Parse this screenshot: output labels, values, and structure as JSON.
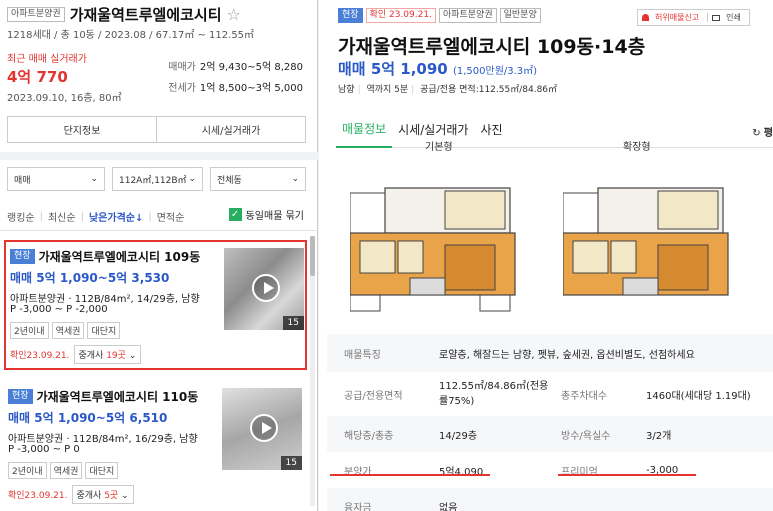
{
  "complex": {
    "type_tag": "아파트분양권",
    "name": "가재울역트루엘에코시티",
    "summary": "1218세대 / 총 10동 / 2023.08 / 67.17㎡ ~ 112.55㎡",
    "recent_label": "최근 매매 실거래가",
    "recent_price": "4억 770",
    "recent_date": "2023.09.10, 16층, 80㎡",
    "sale_range_label": "매매가",
    "sale_range": "2억 9,430~5억 8,280",
    "jeonse_range_label": "전세가",
    "jeonse_range": "1억 8,500~3억 5,000",
    "btn_info": "단지정보",
    "btn_price": "시세/실거래가"
  },
  "filters": {
    "trade": "매매",
    "area": "112A㎡,112B㎡",
    "dong": "전체동"
  },
  "sort": {
    "items": [
      "랭킹순",
      "최신순",
      "낮은가격순↓",
      "면적순"
    ],
    "bundle": "동일매물 묶기"
  },
  "listings": [
    {
      "badge": "현장",
      "name": "가재울역트루엘에코시티 109동",
      "price": "매매 5억 1,090~5억 3,530",
      "line1": "아파트분양권 · 112B/84m², 14/29층, 남향",
      "line2": "P -3,000 ~ P -2,000",
      "chips": [
        "2년이내",
        "역세권",
        "대단지"
      ],
      "confirmed": "확인23.09.21.",
      "agents_prefix": "중개사 ",
      "agents_count": "19곳",
      "photo_count": "15"
    },
    {
      "badge": "현장",
      "name": "가재울역트루엘에코시티 110동",
      "price": "매매 5억 1,090~5억 6,510",
      "line1": "아파트분양권 · 112B/84m², 16/29층, 남향",
      "line2": "P -3,000 ~ P 0",
      "chips": [
        "2년이내",
        "역세권",
        "대단지"
      ],
      "confirmed": "확인23.09.21.",
      "agents_prefix": "중개사 ",
      "agents_count": "5곳",
      "photo_count": "15"
    }
  ],
  "detail": {
    "tags": [
      "현장",
      "확인 23.09.21.",
      "아파트분양권",
      "일반분양"
    ],
    "report": "허위매물신고",
    "print": "인쇄",
    "title": "가재울역트루엘에코시티 109동·14층",
    "price": "매매 5억 1,090",
    "price_per": "(1,500만원/3.3㎡)",
    "meta": [
      "남향",
      "역까지 5분",
      "공급/전용 면적:112.55㎡/84.86㎡"
    ],
    "tabs": [
      "매물정보",
      "시세/실거래가",
      "사진"
    ],
    "tab_right": "평",
    "plan_basic": "기본형",
    "plan_ext": "확장형",
    "rows": [
      {
        "k": "매물특징",
        "v": "로얄층, 해잘드는 남향, 펫뷰, 숲세권, 옵션비별도, 선점하세요"
      },
      {
        "k": "공급/전용면적",
        "v": "112.55㎡/84.86㎡(전용률75%)",
        "k2": "총주차대수",
        "v2": "1460대(세대당 1.19대)"
      },
      {
        "k": "해당층/총층",
        "v": "14/29층",
        "k2": "방수/욕실수",
        "v2": "3/2개"
      },
      {
        "k": "분양가",
        "v": "5억4,090",
        "k2": "프리미엄",
        "v2": "-3,000"
      },
      {
        "k": "융자금",
        "v": "없음"
      }
    ]
  }
}
